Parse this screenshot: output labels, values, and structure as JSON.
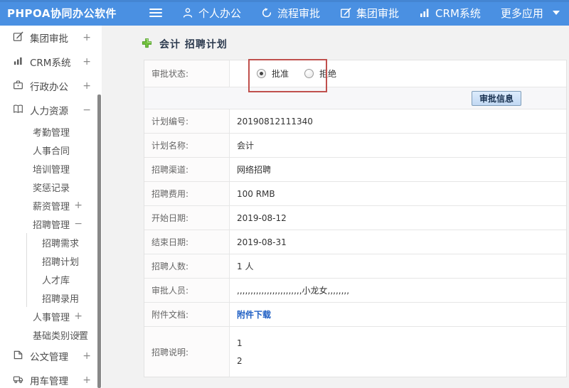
{
  "topbar": {
    "logo": "PHPOA协同办公软件",
    "nav": [
      {
        "label": "个人办公",
        "icon": "person-icon"
      },
      {
        "label": "流程审批",
        "icon": "process-icon"
      },
      {
        "label": "集团审批",
        "icon": "edit-icon"
      },
      {
        "label": "CRM系统",
        "icon": "chart-icon"
      },
      {
        "label": "更多应用",
        "icon": "caret-down-icon"
      }
    ]
  },
  "sidebar": {
    "items": [
      {
        "label": "集团审批",
        "toggle": "+",
        "icon": "edit-icon"
      },
      {
        "label": "CRM系统",
        "toggle": "+",
        "icon": "chart-icon"
      },
      {
        "label": "行政办公",
        "toggle": "+",
        "icon": "briefcase-icon"
      },
      {
        "label": "人力资源",
        "toggle": "−",
        "icon": "book-icon"
      },
      {
        "label": "考勤管理"
      },
      {
        "label": "人事合同"
      },
      {
        "label": "培训管理"
      },
      {
        "label": "奖惩记录"
      },
      {
        "label": "薪资管理",
        "toggle": "+"
      },
      {
        "label": "招聘管理",
        "toggle": "−"
      },
      {
        "label": "招聘需求"
      },
      {
        "label": "招聘计划"
      },
      {
        "label": "人才库"
      },
      {
        "label": "招聘录用"
      },
      {
        "label": "人事管理",
        "toggle": "+"
      },
      {
        "label": "基础类别设置",
        "toggle": "+"
      },
      {
        "label": "公文管理",
        "toggle": "+",
        "icon": "document-icon"
      },
      {
        "label": "用车管理",
        "toggle": "+",
        "icon": "truck-icon"
      }
    ]
  },
  "main": {
    "title": "会计 招聘计划",
    "approval": {
      "label": "审批状态:",
      "approve": "批准",
      "reject": "拒绝",
      "selected": "批准"
    },
    "approval_button": "审批信息",
    "fields": [
      {
        "label": "计划编号:",
        "value": "20190812111340"
      },
      {
        "label": "计划名称:",
        "value": "会计"
      },
      {
        "label": "招聘渠道:",
        "value": "网络招聘"
      },
      {
        "label": "招聘费用:",
        "value": "100 RMB"
      },
      {
        "label": "开始日期:",
        "value": "2019-08-12"
      },
      {
        "label": "结束日期:",
        "value": "2019-08-31"
      },
      {
        "label": "招聘人数:",
        "value": "1 人"
      },
      {
        "label": "审批人员:",
        "value": ",,,,,,,,,,,,,,,,,,,,,,,,小龙女,,,,,,,,"
      }
    ],
    "attachment": {
      "label": "附件文档:",
      "link_text": "附件下载"
    },
    "description": {
      "label": "招聘说明:",
      "line1": "1",
      "line2": "2"
    }
  }
}
